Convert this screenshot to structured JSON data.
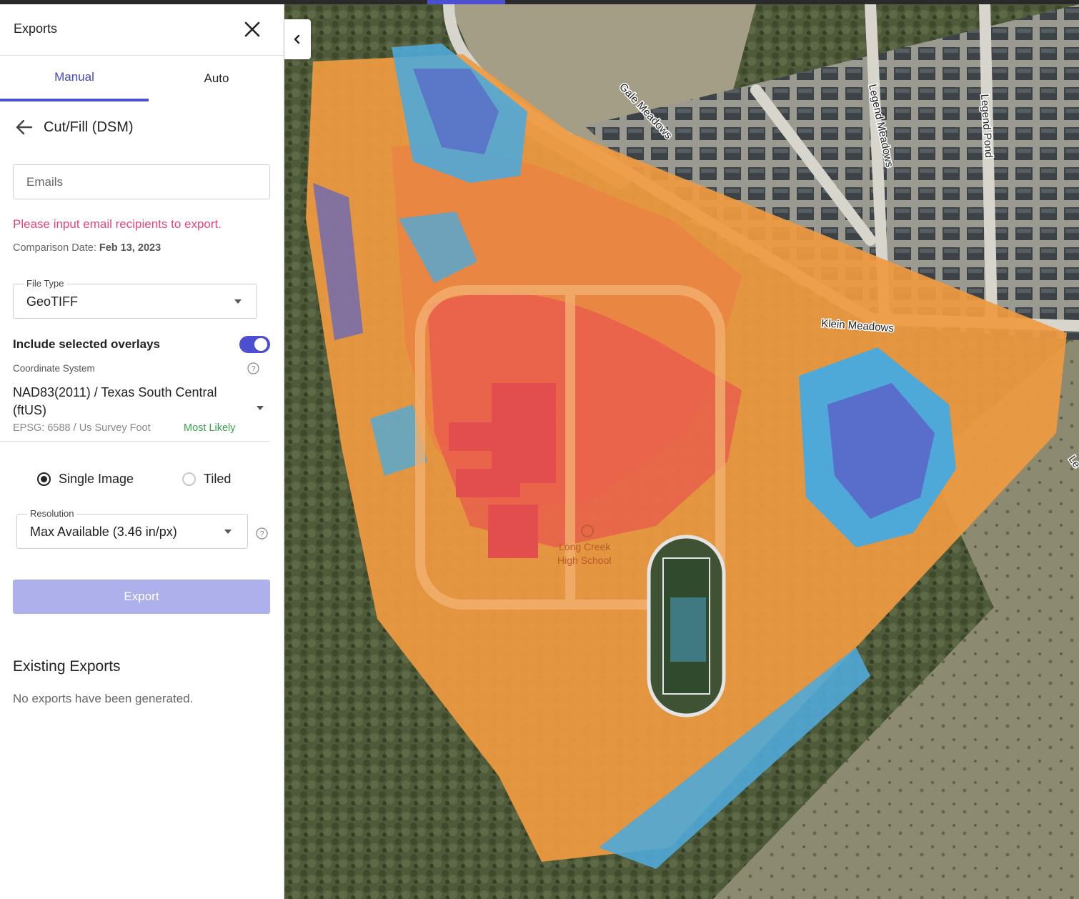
{
  "panel": {
    "title": "Exports",
    "close_icon": "close-icon",
    "tabs": [
      {
        "label": "Manual",
        "active": true
      },
      {
        "label": "Auto",
        "active": false
      }
    ],
    "section_title": "Cut/Fill (DSM)",
    "back_icon": "arrow-left-icon",
    "emails": {
      "placeholder": "Emails",
      "value": ""
    },
    "error_text": "Please input email recipients to export.",
    "comparison": {
      "label": "Comparison Date:",
      "value": "Feb 13, 2023"
    },
    "file_type": {
      "label": "File Type",
      "value": "GeoTIFF"
    },
    "overlays": {
      "label": "Include selected overlays",
      "enabled": true
    },
    "coordinate_system": {
      "label": "Coordinate System",
      "value": "NAD83(2011) / Texas South Central (ftUS)",
      "epsg": "EPSG: 6588 / Us Survey Foot",
      "badge": "Most Likely"
    },
    "image_mode": {
      "options": [
        "Single Image",
        "Tiled"
      ],
      "selected": "Single Image"
    },
    "resolution": {
      "label": "Resolution",
      "value": "Max Available (3.46 in/px)"
    },
    "export_button": "Export",
    "existing_exports": {
      "title": "Existing Exports",
      "empty_text": "No exports have been generated."
    }
  },
  "map": {
    "collapse_icon": "chevron-left-icon",
    "road_labels": [
      "Gale Meadows",
      "Legend Meadows",
      "Legend Pond",
      "Klein Meadows",
      "Le"
    ],
    "poi_label": [
      "Long Creek",
      "High School"
    ],
    "colors": {
      "fill": "#f09a40",
      "cut": "#e8584e",
      "low": "#4fa9d8",
      "deep": "#5a63c8",
      "accent": "#4b4fd0"
    }
  }
}
